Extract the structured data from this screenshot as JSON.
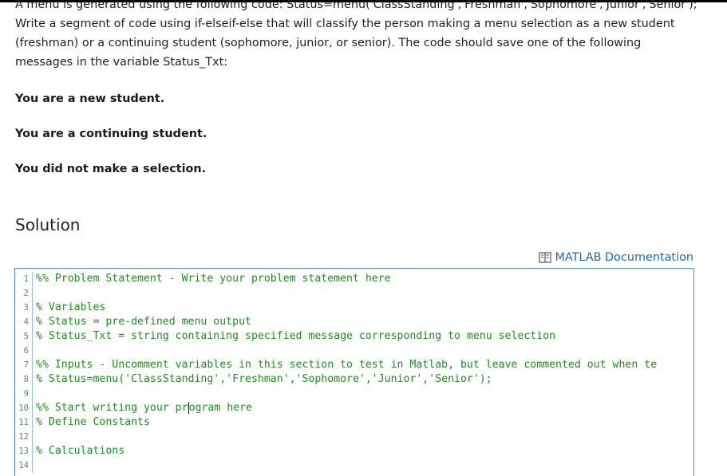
{
  "problem": {
    "prompt_text": "A menu is generated using the following code: Status=menu('ClassStanding','Freshman','Sophomore','Junior','Senior'); Write a segment of code using if-elseif-else that will classify the person making a menu selection as a new student (freshman) or a continuing student (sophomore, junior, or senior). The code should save one of the following messages in the variable Status_Txt:",
    "messages": [
      "You are a new student.",
      "You are a continuing student.",
      "You did not make a selection."
    ]
  },
  "solution": {
    "heading": "Solution",
    "doc_link_label": "MATLAB Documentation",
    "doc_icon": "book-icon"
  },
  "editor": {
    "cursor_line": 10,
    "lines": [
      {
        "num": "1",
        "text": "%% Problem Statement - Write your problem statement here"
      },
      {
        "num": "2",
        "text": ""
      },
      {
        "num": "3",
        "text": "% Variables"
      },
      {
        "num": "4",
        "text": "% Status = pre-defined menu output"
      },
      {
        "num": "5",
        "text": "% Status_Txt = string containing specified message corresponding to menu selection"
      },
      {
        "num": "6",
        "text": ""
      },
      {
        "num": "7",
        "text": "%% Inputs - Uncomment variables in this section to test in Matlab, but leave commented out when te"
      },
      {
        "num": "8",
        "text": "% Status=menu('ClassStanding','Freshman','Sophomore','Junior','Senior');"
      },
      {
        "num": "9",
        "text": ""
      },
      {
        "num": "10",
        "text": "%% Start writing your program here"
      },
      {
        "num": "11",
        "text": "% Define Constants"
      },
      {
        "num": "12",
        "text": ""
      },
      {
        "num": "13",
        "text": "% Calculations"
      },
      {
        "num": "14",
        "text": ""
      }
    ]
  },
  "colors": {
    "comment": "#228b22",
    "link": "#1f6bb8",
    "editor_border": "#4a90d9"
  }
}
